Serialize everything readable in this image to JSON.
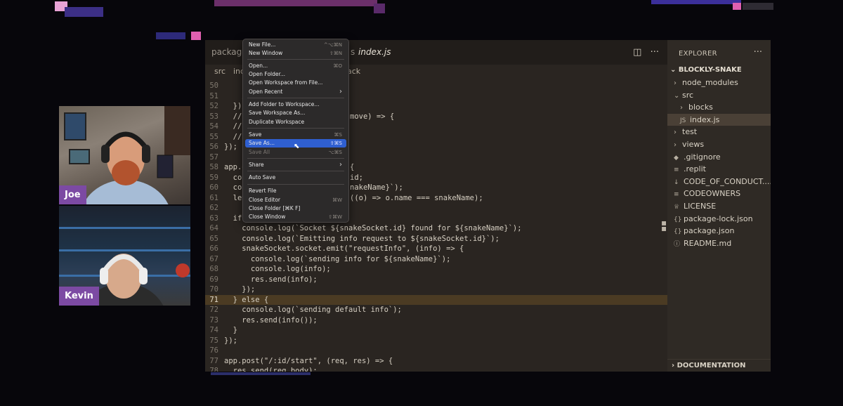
{
  "cams": {
    "joe": {
      "name": "Joe"
    },
    "kevin": {
      "name": "Kevin"
    }
  },
  "editor": {
    "tabs": {
      "tab1": "package.",
      "tab2_suffix": "s",
      "active": "index.js"
    },
    "breadcrumb": {
      "src": "src",
      "in": "inc",
      "tail": "ack"
    },
    "lines": [
      {
        "n": "50",
        "t": ""
      },
      {
        "n": "51",
        "t": "    /"
      },
      {
        "n": "52",
        "t": "  });"
      },
      {
        "n": "53",
        "t": "  //",
        "tail": "move) => {"
      },
      {
        "n": "54",
        "t": "  //"
      },
      {
        "n": "55",
        "t": "  //"
      },
      {
        "n": "56",
        "t": "});"
      },
      {
        "n": "57",
        "t": ""
      },
      {
        "n": "58",
        "t": "app.g",
        "tail": "{"
      },
      {
        "n": "59",
        "t": "  cons",
        "tail": "id;"
      },
      {
        "n": "60",
        "t": "  con",
        "tail": "nakeName}`);"
      },
      {
        "n": "61",
        "t": "  let",
        "tail": "((o) => o.name === snakeName);"
      },
      {
        "n": "62",
        "t": ""
      },
      {
        "n": "63",
        "t": "  if"
      },
      {
        "n": "64",
        "t": "    console.log(`Socket ${snakeSocket.id} found for ${snakeName}`);"
      },
      {
        "n": "65",
        "t": "    console.log(`Emitting info request to ${snakeSocket.id}`);"
      },
      {
        "n": "66",
        "t": "    snakeSocket.socket.emit(\"requestInfo\", (info) => {"
      },
      {
        "n": "67",
        "t": "      console.log(`sending info for ${snakeName}`);"
      },
      {
        "n": "68",
        "t": "      console.log(info);"
      },
      {
        "n": "69",
        "t": "      res.send(info);"
      },
      {
        "n": "70",
        "t": "    });"
      },
      {
        "n": "71",
        "t": "  } else {",
        "hl": true
      },
      {
        "n": "72",
        "t": "    console.log(`sending default info`);"
      },
      {
        "n": "73",
        "t": "    res.send(info());"
      },
      {
        "n": "74",
        "t": "  }"
      },
      {
        "n": "75",
        "t": "});"
      },
      {
        "n": "76",
        "t": ""
      },
      {
        "n": "77",
        "t": "app.post(\"/:id/start\", (req, res) => {"
      },
      {
        "n": "78",
        "t": "  res.send(req.body);"
      }
    ]
  },
  "menu": {
    "items": [
      {
        "label": "New File...",
        "shortcut": "^⌥⌘N"
      },
      {
        "label": "New Window",
        "shortcut": "⇧⌘N"
      },
      {
        "label": "Open...",
        "shortcut": "⌘O"
      },
      {
        "label": "Open Folder...",
        "shortcut": ""
      },
      {
        "label": "Open Workspace from File...",
        "shortcut": ""
      },
      {
        "label": "Open Recent",
        "shortcut": "›"
      },
      {
        "label": "Add Folder to Workspace...",
        "shortcut": ""
      },
      {
        "label": "Save Workspace As...",
        "shortcut": ""
      },
      {
        "label": "Duplicate Workspace",
        "shortcut": ""
      },
      {
        "label": "Save",
        "shortcut": "⌘S"
      },
      {
        "label": "Save As...",
        "shortcut": "⇧⌘S"
      },
      {
        "label": "Save All",
        "shortcut": "⌥⌘S"
      },
      {
        "label": "Share",
        "shortcut": "›"
      },
      {
        "label": "Auto Save",
        "shortcut": ""
      },
      {
        "label": "Revert File",
        "shortcut": ""
      },
      {
        "label": "Close Editor",
        "shortcut": "⌘W"
      },
      {
        "label": "Close Folder [⌘K F]",
        "shortcut": ""
      },
      {
        "label": "Close Window",
        "shortcut": "⇧⌘W"
      }
    ]
  },
  "sidebar": {
    "title": "EXPLORER",
    "root": "BLOCKLY-SNAKE",
    "items": [
      {
        "label": "node_modules",
        "chev": "›",
        "icon": ""
      },
      {
        "label": "src",
        "chev": "⌄",
        "icon": ""
      },
      {
        "label": "blocks",
        "chev": "›",
        "icon": ""
      },
      {
        "label": "index.js",
        "chev": "",
        "icon": "JS"
      },
      {
        "label": "test",
        "chev": "›",
        "icon": ""
      },
      {
        "label": "views",
        "chev": "›",
        "icon": ""
      },
      {
        "label": ".gitignore",
        "chev": "",
        "icon": "◆"
      },
      {
        "label": ".replit",
        "chev": "",
        "icon": "≡"
      },
      {
        "label": "CODE_OF_CONDUCT....",
        "chev": "",
        "icon": "↓"
      },
      {
        "label": "CODEOWNERS",
        "chev": "",
        "icon": "≡"
      },
      {
        "label": "LICENSE",
        "chev": "",
        "icon": "♕"
      },
      {
        "label": "package-lock.json",
        "chev": "",
        "icon": "{}"
      },
      {
        "label": "package.json",
        "chev": "",
        "icon": "{}"
      },
      {
        "label": "README.md",
        "chev": "",
        "icon": "ⓘ"
      }
    ],
    "footer": "DOCUMENTATION"
  }
}
